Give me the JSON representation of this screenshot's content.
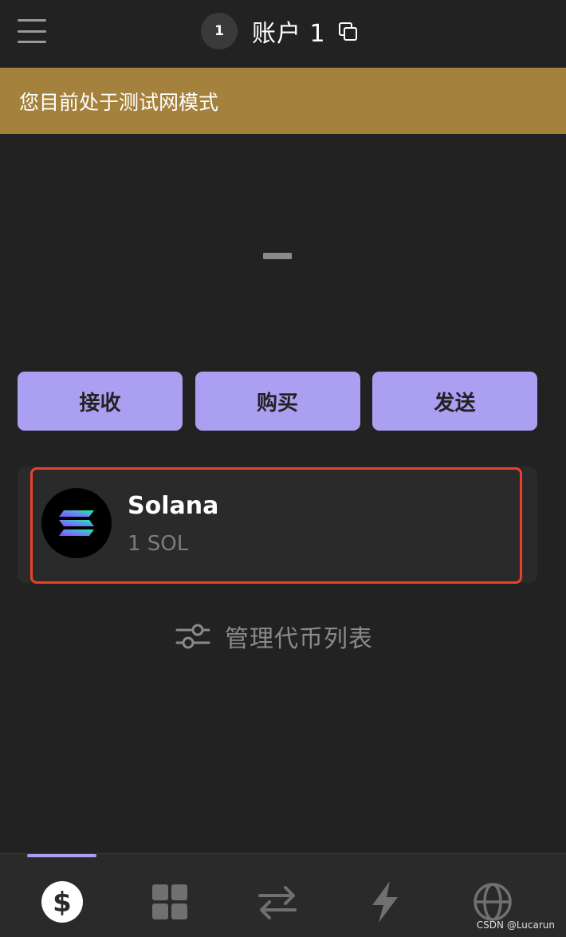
{
  "header": {
    "account_number": "1",
    "account_name": "账户 1"
  },
  "banner": {
    "text": "您目前处于测试网模式",
    "color": "#a4813c"
  },
  "balance": {
    "display": "placeholder-dash"
  },
  "actions": [
    {
      "label": "接收"
    },
    {
      "label": "购买"
    },
    {
      "label": "发送"
    }
  ],
  "accent_color": "#ab9ff2",
  "tokens": [
    {
      "name": "Solana",
      "amount": "1 SOL",
      "icon": "solana-logo-icon"
    }
  ],
  "manage": {
    "label": "管理代币列表",
    "icon": "sliders-icon"
  },
  "bottom_nav": {
    "active_index": 0,
    "tabs": [
      {
        "icon": "dollar-icon"
      },
      {
        "icon": "grid-icon"
      },
      {
        "icon": "swap-arrows-icon"
      },
      {
        "icon": "lightning-icon"
      },
      {
        "icon": "globe-icon"
      }
    ]
  },
  "watermark": "CSDN @Lucarun",
  "highlight_color": "#e8412c"
}
